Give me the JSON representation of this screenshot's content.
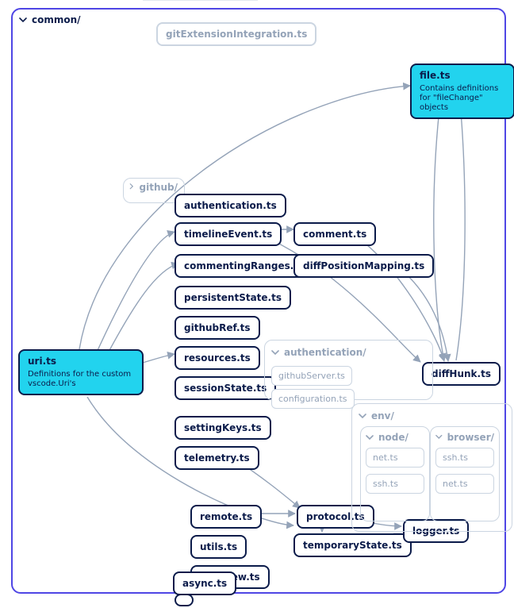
{
  "groups": {
    "common": {
      "label": "common/"
    },
    "github": {
      "label": "github/"
    },
    "authentication": {
      "label": "authentication/"
    },
    "env": {
      "label": "env/"
    },
    "env_node": {
      "label": "node/"
    },
    "env_browser": {
      "label": "browser/"
    }
  },
  "nodes": {
    "gitExtensionIntegration": {
      "label": "gitExtensionIntegration.ts"
    },
    "file": {
      "label": "file.ts",
      "desc": "Contains definitions for \"fileChange\" objects"
    },
    "uri": {
      "label": "uri.ts",
      "desc": "Definitions for the custom vscode.Uri's"
    },
    "authentication": {
      "label": "authentication.ts"
    },
    "timelineEvent": {
      "label": "timelineEvent.ts"
    },
    "comment": {
      "label": "comment.ts"
    },
    "commentingRanges": {
      "label": "commentingRanges.ts"
    },
    "diffPositionMapping": {
      "label": "diffPositionMapping.ts"
    },
    "persistentState": {
      "label": "persistentState.ts"
    },
    "githubRef": {
      "label": "githubRef.ts"
    },
    "resources": {
      "label": "resources.ts"
    },
    "sessionState": {
      "label": "sessionState.ts"
    },
    "settingKeys": {
      "label": "settingKeys.ts"
    },
    "telemetry": {
      "label": "telemetry.ts"
    },
    "remote": {
      "label": "remote.ts"
    },
    "utils": {
      "label": "utils.ts"
    },
    "webview": {
      "label": "webview.ts"
    },
    "async": {
      "label": "async.ts"
    },
    "protocol": {
      "label": "protocol.ts"
    },
    "temporaryState": {
      "label": "temporaryState.ts"
    },
    "logger": {
      "label": "logger.ts"
    },
    "diffHunk": {
      "label": "diffHunk.ts"
    },
    "githubServer": {
      "label": "githubServer.ts"
    },
    "configuration": {
      "label": "configuration.ts"
    },
    "env_node_net": {
      "label": "net.ts"
    },
    "env_node_ssh": {
      "label": "ssh.ts"
    },
    "env_browser_ssh": {
      "label": "ssh.ts"
    },
    "env_browser_net": {
      "label": "net.ts"
    }
  },
  "edges": [
    [
      "uri",
      "file"
    ],
    [
      "uri",
      "timelineEvent"
    ],
    [
      "uri",
      "commentingRanges"
    ],
    [
      "uri",
      "resources"
    ],
    [
      "uri",
      "temporaryState"
    ],
    [
      "timelineEvent",
      "comment"
    ],
    [
      "timelineEvent",
      "diffHunk"
    ],
    [
      "comment",
      "diffHunk"
    ],
    [
      "commentingRanges",
      "diffPositionMapping"
    ],
    [
      "diffPositionMapping",
      "diffHunk"
    ],
    [
      "file",
      "diffHunk"
    ],
    [
      "diffHunk",
      "file"
    ],
    [
      "telemetry",
      "protocol"
    ],
    [
      "remote",
      "protocol"
    ],
    [
      "protocol",
      "logger"
    ],
    [
      "protocol",
      "temporaryState"
    ],
    [
      "temporaryState",
      "logger"
    ]
  ]
}
